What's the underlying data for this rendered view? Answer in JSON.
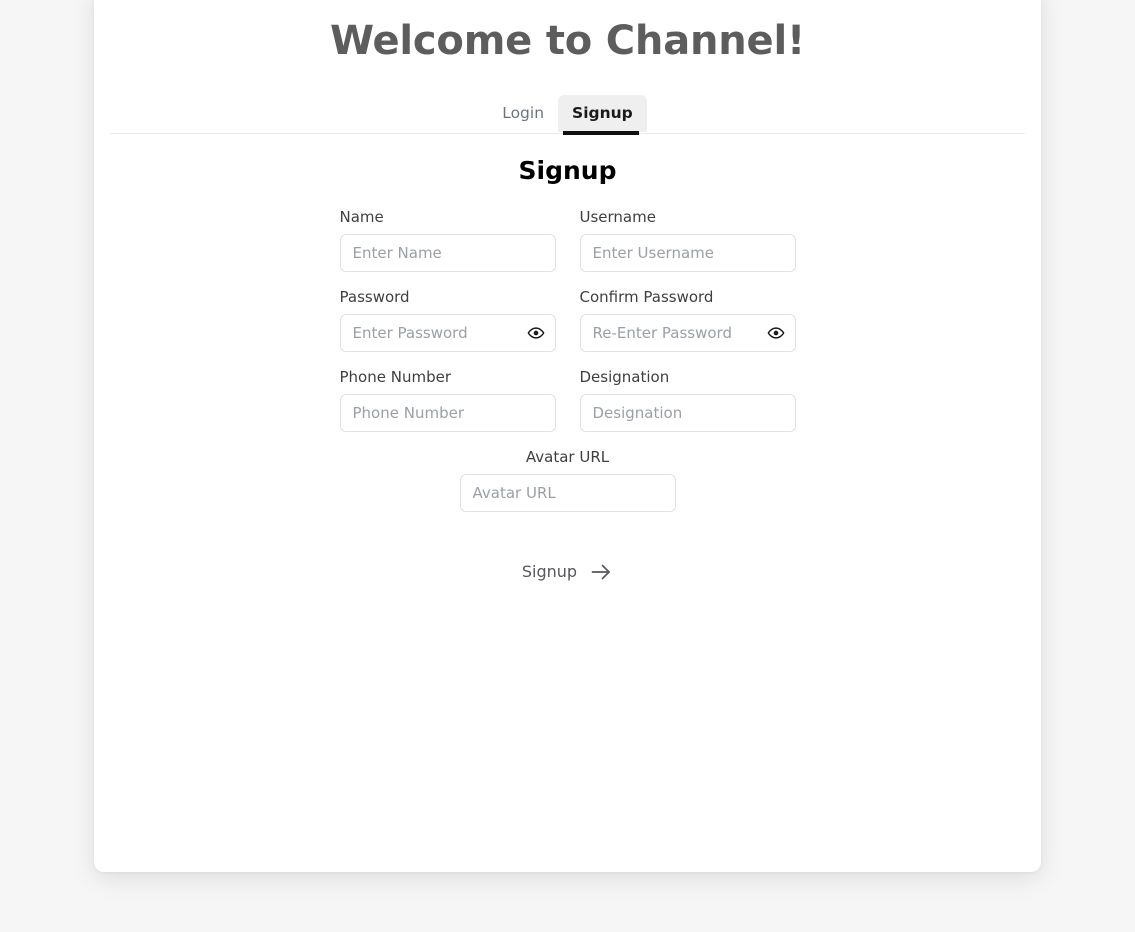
{
  "page": {
    "title": "Welcome to Channel!"
  },
  "tabs": {
    "items": [
      {
        "label": "Login",
        "active": false
      },
      {
        "label": "Signup",
        "active": true
      }
    ]
  },
  "form": {
    "heading": "Signup",
    "fields": [
      {
        "label": "Name",
        "placeholder": "Enter Name",
        "value": "",
        "type": "text",
        "icon": null
      },
      {
        "label": "Username",
        "placeholder": "Enter Username",
        "value": "",
        "type": "text",
        "icon": null
      },
      {
        "label": "Password",
        "placeholder": "Enter Password",
        "value": "",
        "type": "password",
        "icon": "eye-icon"
      },
      {
        "label": "Confirm Password",
        "placeholder": "Re-Enter Password",
        "value": "",
        "type": "password",
        "icon": "eye-icon"
      },
      {
        "label": "Phone Number",
        "placeholder": "Phone Number",
        "value": "",
        "type": "text",
        "icon": null
      },
      {
        "label": "Designation",
        "placeholder": "Designation",
        "value": "",
        "type": "text",
        "icon": null
      },
      {
        "label": "Avatar URL",
        "placeholder": "Avatar URL",
        "value": "",
        "type": "text",
        "icon": null
      }
    ],
    "submit": {
      "label": "Signup",
      "icon": "arrow-right-icon"
    }
  },
  "colors": {
    "page_background": "#f6f6f6",
    "card_background": "#ffffff",
    "title_text": "#5d5d5d",
    "heading_text": "#000000",
    "label_text": "#3f3f3f",
    "placeholder_text": "#9aa0a6",
    "input_border": "#dee2e6",
    "tab_inactive_text": "#6c757d",
    "tab_active_text": "#1b1b1b",
    "tab_active_background": "#efefef",
    "tab_active_underline": "#111111",
    "submit_text": "#55585c"
  }
}
